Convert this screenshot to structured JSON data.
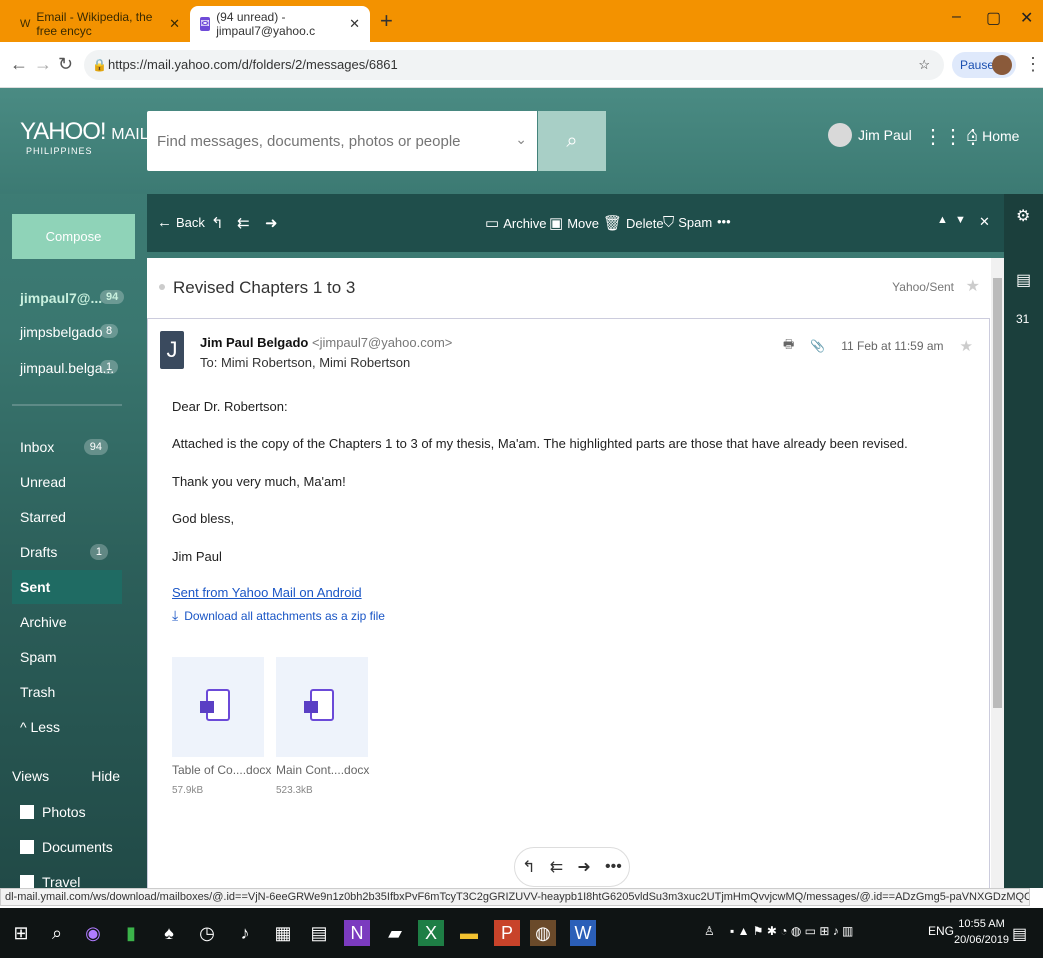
{
  "browser": {
    "tabs": [
      {
        "label": "Email - Wikipedia, the free encyc"
      },
      {
        "label": "(94 unread) - jimpaul7@yahoo.c"
      }
    ],
    "url": "https://mail.yahoo.com/d/folders/2/messages/6861",
    "paused_label": "Paused"
  },
  "header": {
    "logo": "YAHOO!",
    "logo_mail": "MAIL",
    "logo_sub": "PHILIPPINES",
    "search_placeholder": "Find messages, documents, photos or people",
    "user_name": "Jim Paul",
    "home_label": "Home"
  },
  "sidebar": {
    "compose_label": "Compose",
    "accounts": [
      {
        "name": "jimpaul7@...",
        "count": "94"
      },
      {
        "name": "jimpsbelgado",
        "count": "8"
      },
      {
        "name": "jimpaul.belga...",
        "count": "1"
      }
    ],
    "folders": [
      {
        "label": "Inbox",
        "count": "94"
      },
      {
        "label": "Unread",
        "count": ""
      },
      {
        "label": "Starred",
        "count": ""
      },
      {
        "label": "Drafts",
        "count": "1"
      },
      {
        "label": "Sent",
        "count": ""
      },
      {
        "label": "Archive",
        "count": ""
      },
      {
        "label": "Spam",
        "count": ""
      },
      {
        "label": "Trash",
        "count": ""
      },
      {
        "label": "^ Less",
        "count": ""
      }
    ],
    "views_label": "Views",
    "hide_label": "Hide",
    "views": [
      {
        "label": "Photos"
      },
      {
        "label": "Documents"
      },
      {
        "label": "Travel"
      }
    ]
  },
  "toolbar": {
    "back": "Back",
    "archive": "Archive",
    "move": "Move",
    "delete": "Delete",
    "spam": "Spam"
  },
  "message": {
    "subject": "Revised Chapters 1 to 3",
    "folder_tag": "Yahoo/Sent",
    "from_name": "Jim Paul Belgado",
    "from_email": "<jimpaul7@yahoo.com>",
    "to": "To: Mimi Robertson,  Mimi Robertson",
    "date": "11 Feb at 11:59 am",
    "body": [
      "Dear Dr. Robertson:",
      "Attached is the copy of the Chapters 1 to 3 of my thesis, Ma'am. The highlighted parts are those that have already been revised.",
      "Thank you very much, Ma'am!",
      "God bless,",
      "Jim Paul"
    ],
    "signature_link": "Sent from Yahoo Mail on Android",
    "download_all": "Download all attachments as a zip file",
    "attachments": [
      {
        "name": "Table of Co....docx",
        "size": "57.9kB"
      },
      {
        "name": "Main Cont....docx",
        "size": "523.3kB"
      }
    ]
  },
  "status_url": "dl-mail.ymail.com/ws/download/mailboxes/@.id==VjN-6eeGRWe9n1z0bh2b35IfbxPvF6mTcyT3C2gGRIZUVV-heaypb1I8htG6205vldSu3m3xuc2UTjmHmQvvjcwMQ/messages/@.id==ADzGmg5-paVNXGDzMQCgKA1Ih2A/content/parts/.../raw?appid=Y...",
  "taskbar": {
    "lang": "ENG",
    "time": "10:55 AM",
    "date": "20/06/2019"
  },
  "colors": {
    "tab_bar": "#f39200",
    "yahoo_green": "#3c7a73",
    "toolbar": "#1f4e4b",
    "compose": "#8fd3b8",
    "link": "#1a56c6"
  }
}
